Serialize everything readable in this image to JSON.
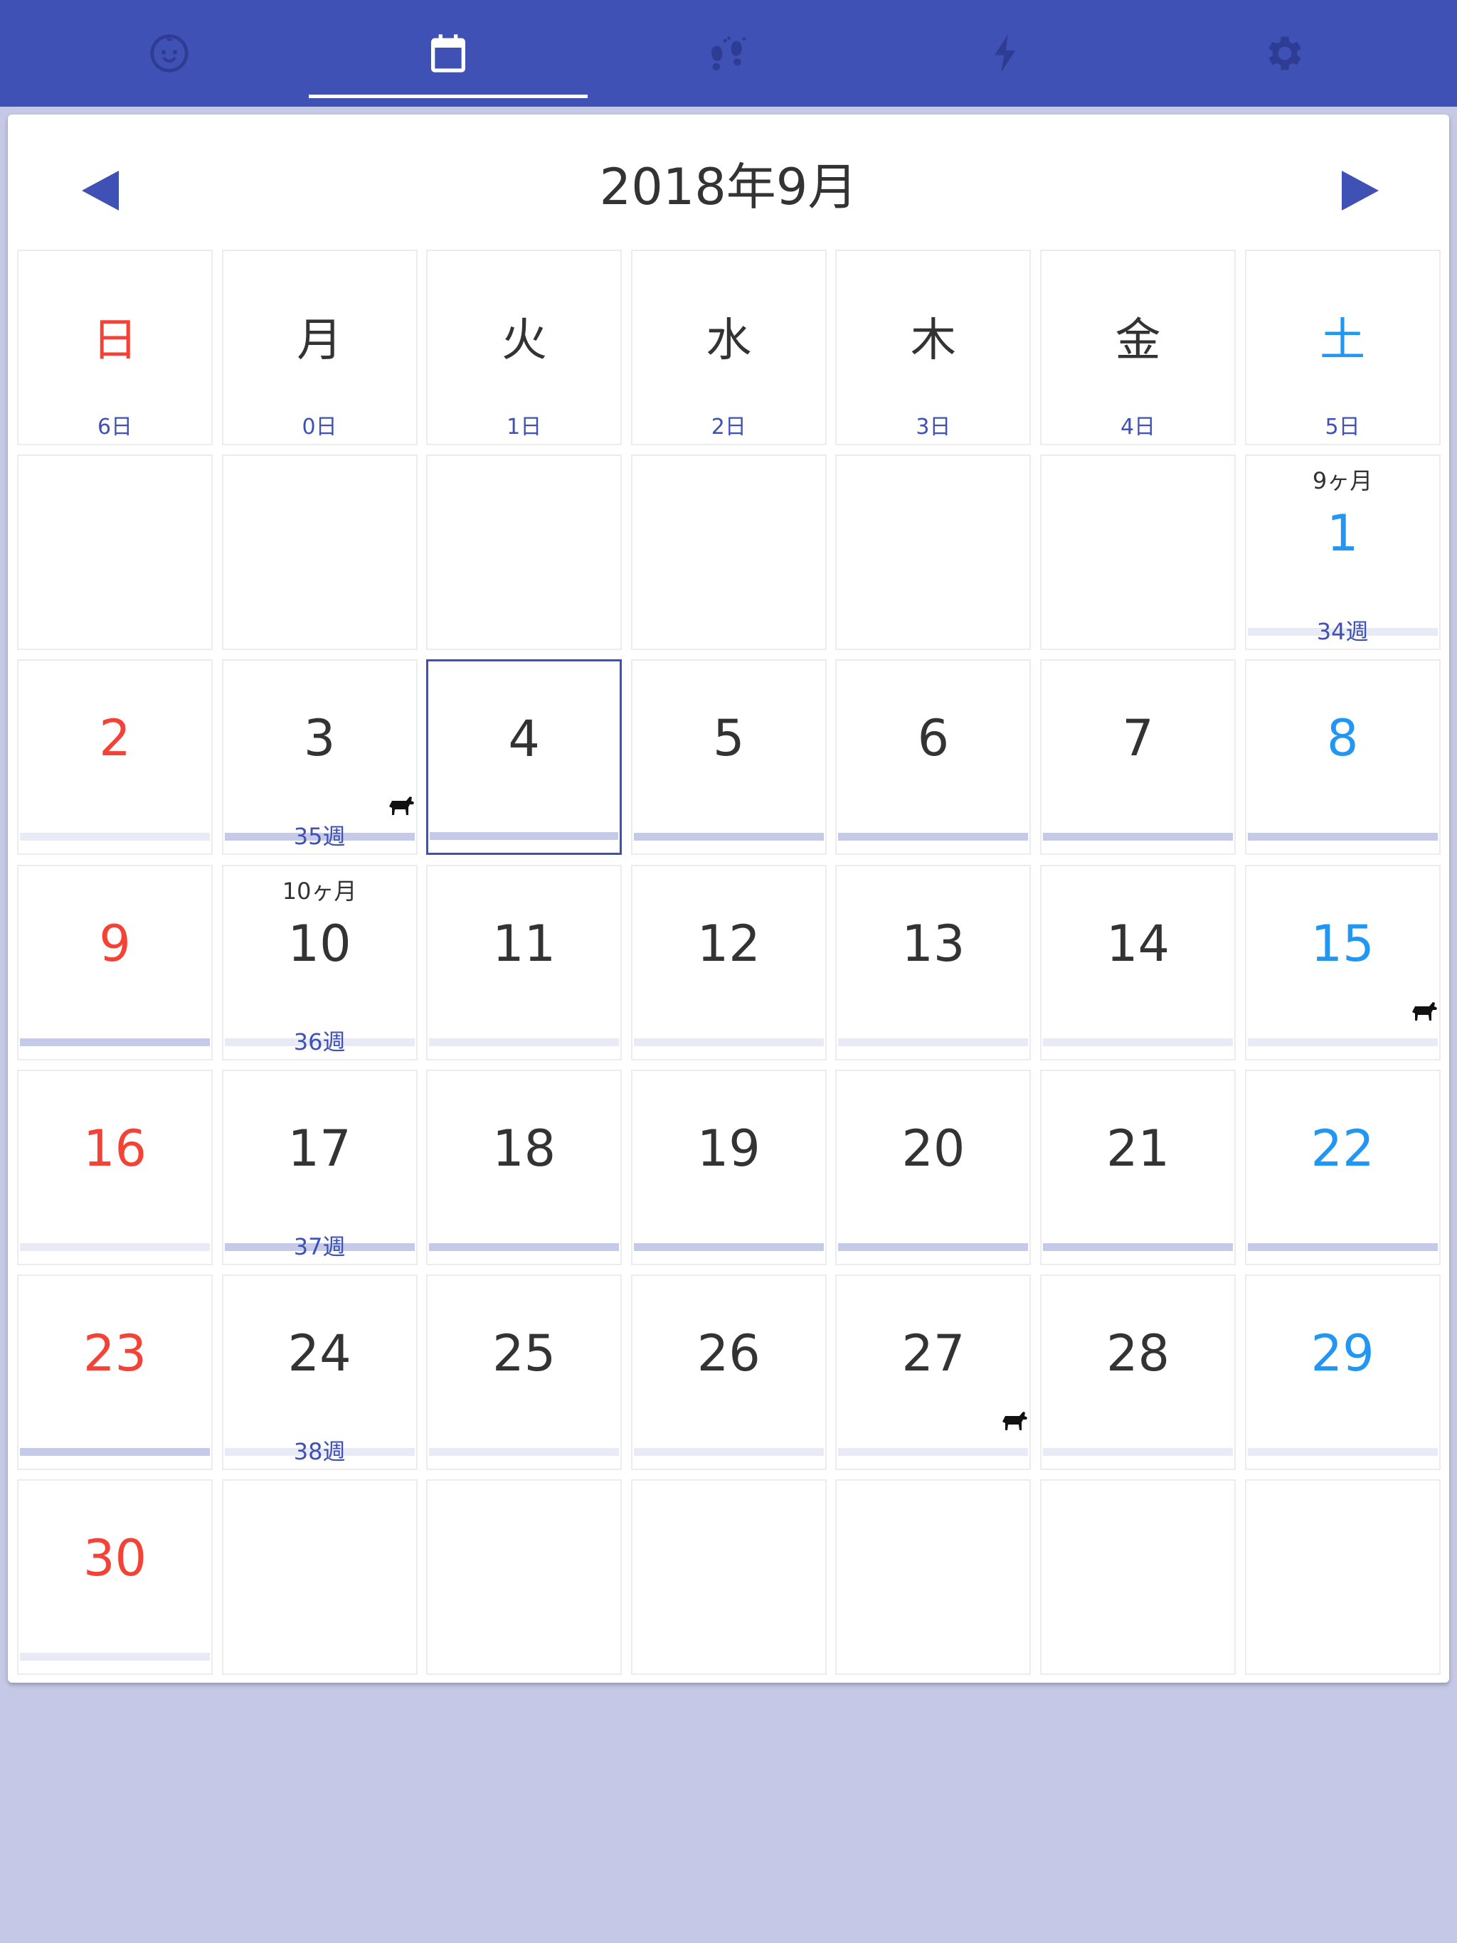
{
  "tabs": [
    {
      "name": "tab-baby",
      "icon": "baby-face-icon",
      "active": false
    },
    {
      "name": "tab-calendar",
      "icon": "calendar-icon",
      "active": true
    },
    {
      "name": "tab-footprints",
      "icon": "footprints-icon",
      "active": false
    },
    {
      "name": "tab-events",
      "icon": "lightning-icon",
      "active": false
    },
    {
      "name": "tab-settings",
      "icon": "gear-icon",
      "active": false
    }
  ],
  "calendar": {
    "title": "2018年9月",
    "prev_icon": "triangle-left-icon",
    "next_icon": "triangle-right-icon",
    "weekdays": [
      {
        "label": "日",
        "count": "6日"
      },
      {
        "label": "月",
        "count": "0日"
      },
      {
        "label": "火",
        "count": "1日"
      },
      {
        "label": "水",
        "count": "2日"
      },
      {
        "label": "木",
        "count": "3日"
      },
      {
        "label": "金",
        "count": "4日"
      },
      {
        "label": "土",
        "count": "5日"
      }
    ],
    "days": [
      {
        "num": "1",
        "month_age": "9ヶ月",
        "week_label": "34週",
        "bar": "light"
      },
      {
        "num": "2",
        "bar": "light"
      },
      {
        "num": "3",
        "week_label": "35週",
        "bar": "strong",
        "dog": true
      },
      {
        "num": "4",
        "bar": "strong",
        "selected": true
      },
      {
        "num": "5",
        "bar": "strong"
      },
      {
        "num": "6",
        "bar": "strong"
      },
      {
        "num": "7",
        "bar": "strong"
      },
      {
        "num": "8",
        "bar": "strong"
      },
      {
        "num": "9",
        "bar": "strong"
      },
      {
        "num": "10",
        "month_age": "10ヶ月",
        "week_label": "36週",
        "bar": "light"
      },
      {
        "num": "11",
        "bar": "light"
      },
      {
        "num": "12",
        "bar": "light"
      },
      {
        "num": "13",
        "bar": "light"
      },
      {
        "num": "14",
        "bar": "light"
      },
      {
        "num": "15",
        "bar": "light",
        "dog": true
      },
      {
        "num": "16",
        "bar": "light"
      },
      {
        "num": "17",
        "week_label": "37週",
        "bar": "strong"
      },
      {
        "num": "18",
        "bar": "strong"
      },
      {
        "num": "19",
        "bar": "strong"
      },
      {
        "num": "20",
        "bar": "strong"
      },
      {
        "num": "21",
        "bar": "strong"
      },
      {
        "num": "22",
        "bar": "strong"
      },
      {
        "num": "23",
        "bar": "strong"
      },
      {
        "num": "24",
        "week_label": "38週",
        "bar": "light"
      },
      {
        "num": "25",
        "bar": "light"
      },
      {
        "num": "26",
        "bar": "light"
      },
      {
        "num": "27",
        "bar": "light",
        "dog": true
      },
      {
        "num": "28",
        "bar": "light"
      },
      {
        "num": "29",
        "bar": "light"
      },
      {
        "num": "30",
        "bar": "light"
      }
    ],
    "first_weekday": 6,
    "total_cells": 42
  },
  "colors": {
    "primary": "#3f51b5",
    "sunday": "#f44336",
    "saturday": "#2196f3",
    "background": "#c5c8e6"
  }
}
